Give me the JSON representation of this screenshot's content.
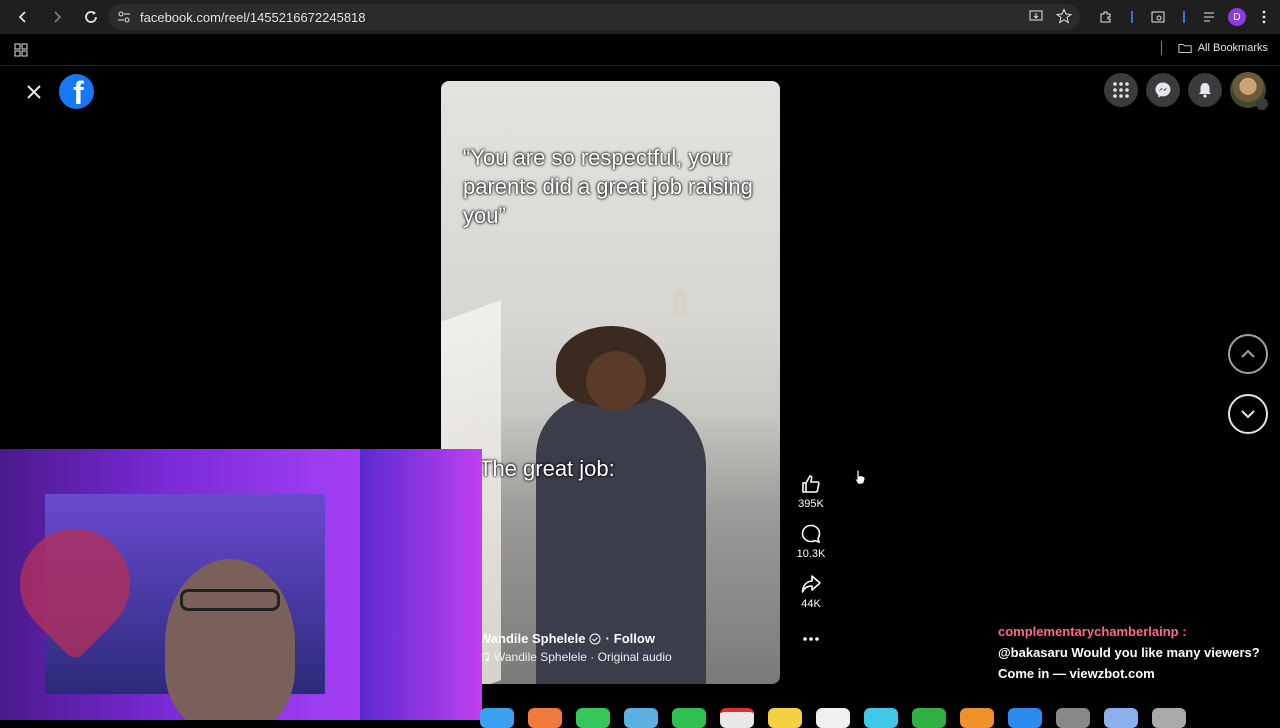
{
  "browser": {
    "url": "facebook.com/reel/1455216672245818",
    "profile_initial": "D",
    "bookmarks_label": "All Bookmarks"
  },
  "reel": {
    "caption_top": "“You are so respectful, your parents did a great job raising you”",
    "caption_mid": "The great job:",
    "creator_name": "Wandile Sphelele",
    "follow_label": "Follow",
    "audio_label": "Wandile Sphelele · Original audio",
    "likes": "395K",
    "comments": "10.3K",
    "shares": "44K"
  },
  "chat": {
    "username": "complementarychamberlainp :",
    "message": "@bakasaru Would you like many viewers? Come in — viewzbot.com"
  },
  "colors": {
    "fb_blue": "#1877f2",
    "chrome_bg": "#1f1f1f",
    "chat_user": "#ff6a8a"
  }
}
